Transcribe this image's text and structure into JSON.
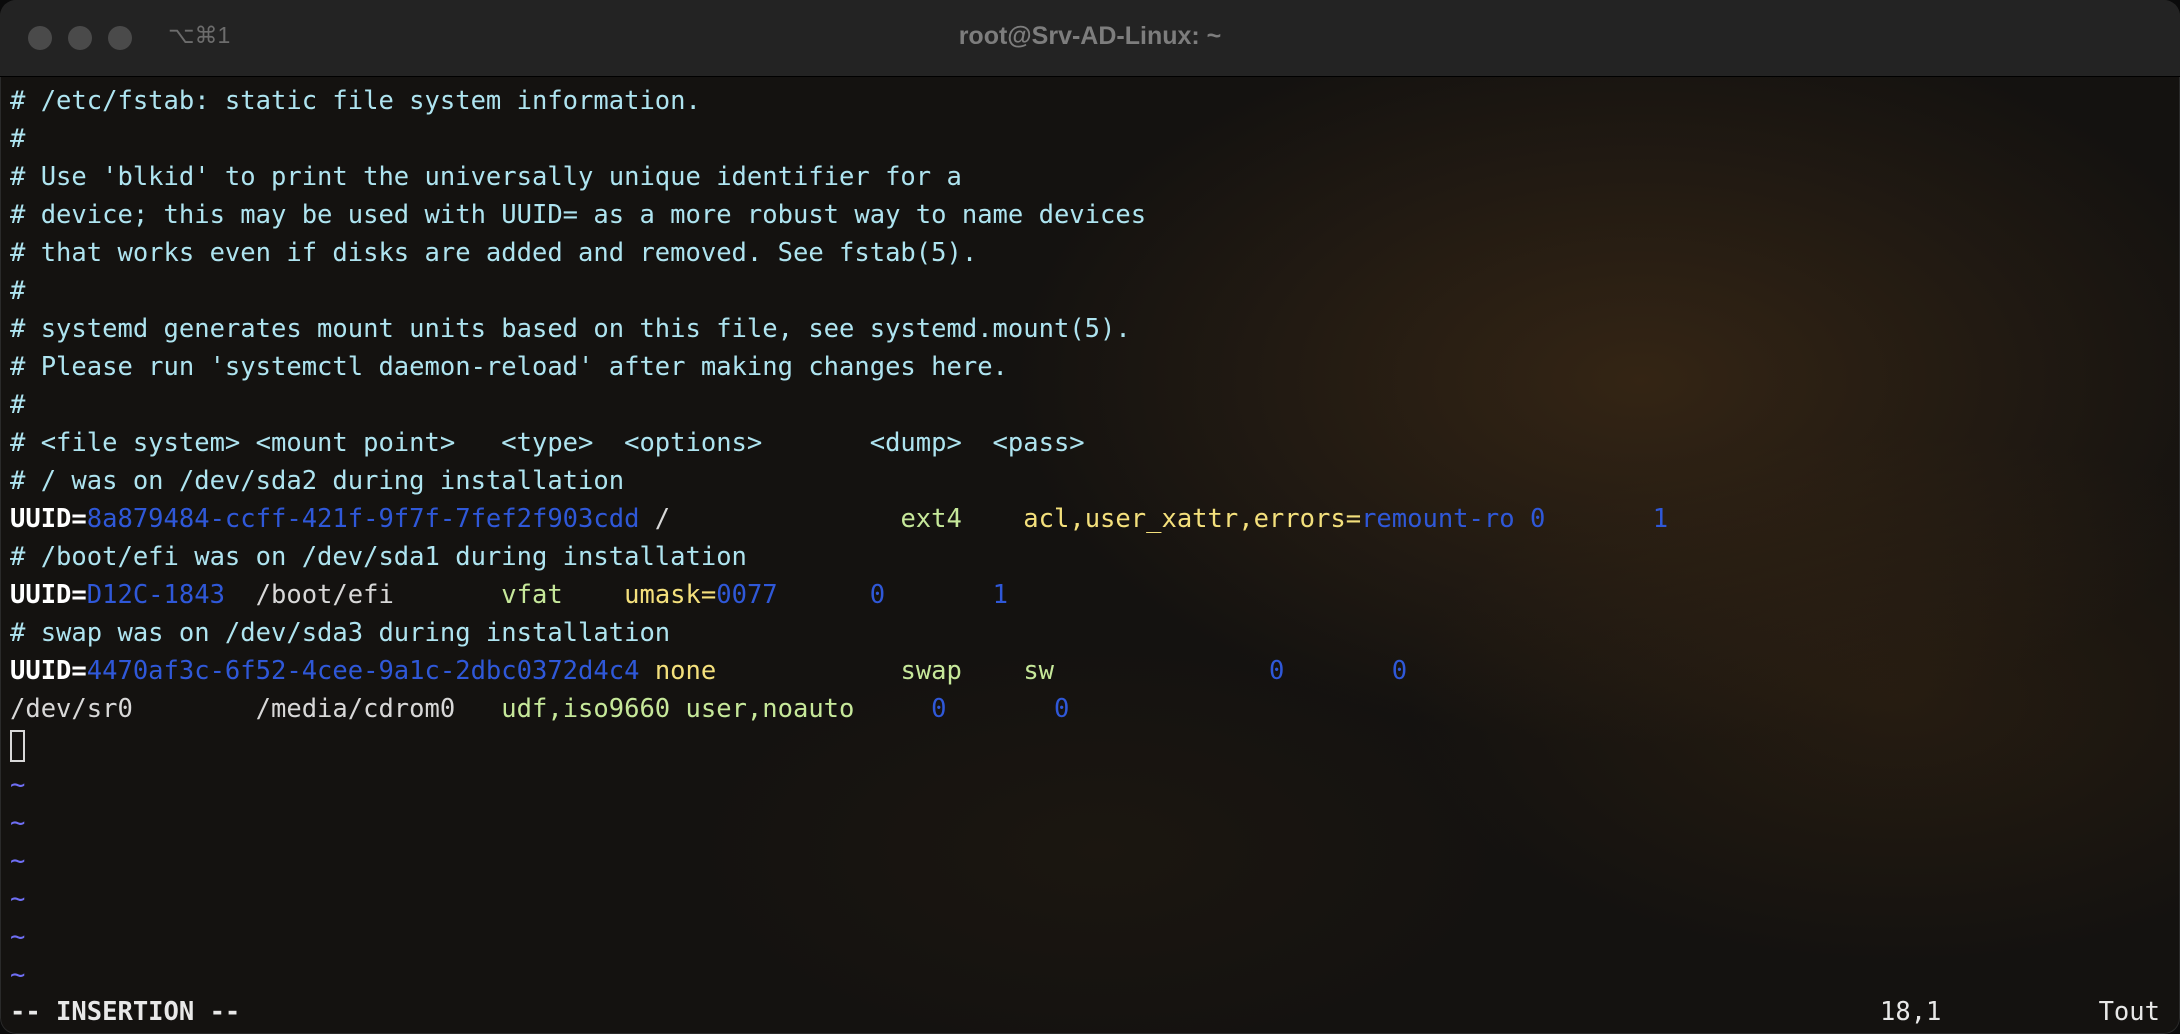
{
  "window": {
    "title": "root@Srv-AD-Linux: ~",
    "shortcut": "⌥⌘1"
  },
  "lines": [
    {
      "cls": "c",
      "text": "# /etc/fstab: static file system information."
    },
    {
      "cls": "c",
      "text": "#"
    },
    {
      "cls": "c",
      "text": "# Use 'blkid' to print the universally unique identifier for a"
    },
    {
      "cls": "c",
      "text": "# device; this may be used with UUID= as a more robust way to name devices"
    },
    {
      "cls": "c",
      "text": "# that works even if disks are added and removed. See fstab(5)."
    },
    {
      "cls": "c",
      "text": "#"
    },
    {
      "cls": "c",
      "text": "# systemd generates mount units based on this file, see systemd.mount(5)."
    },
    {
      "cls": "c",
      "text": "# Please run 'systemctl daemon-reload' after making changes here."
    },
    {
      "cls": "c",
      "text": "#"
    },
    {
      "cls": "c",
      "text": "# <file system> <mount point>   <type>  <options>       <dump>  <pass>"
    },
    {
      "cls": "c",
      "text": "# / was on /dev/sda2 during installation"
    },
    {
      "segments": [
        {
          "cls": "kw",
          "text": "UUID="
        },
        {
          "cls": "b",
          "text": "8a879484-ccff-421f-9f7f-7fef2f903cdd"
        },
        {
          "cls": "w",
          "text": " /               "
        },
        {
          "cls": "g",
          "text": "ext4"
        },
        {
          "cls": "w",
          "text": "    "
        },
        {
          "cls": "y",
          "text": "acl,user_xattr,errors="
        },
        {
          "cls": "b",
          "text": "remount-ro 0       1"
        }
      ]
    },
    {
      "cls": "c",
      "text": "# /boot/efi was on /dev/sda1 during installation"
    },
    {
      "segments": [
        {
          "cls": "kw",
          "text": "UUID="
        },
        {
          "cls": "b",
          "text": "D12C-1843"
        },
        {
          "cls": "w",
          "text": "  /boot/efi       "
        },
        {
          "cls": "g",
          "text": "vfat"
        },
        {
          "cls": "w",
          "text": "    "
        },
        {
          "cls": "y",
          "text": "umask="
        },
        {
          "cls": "b",
          "text": "0077      0       1"
        }
      ]
    },
    {
      "cls": "c",
      "text": "# swap was on /dev/sda3 during installation"
    },
    {
      "segments": [
        {
          "cls": "kw",
          "text": "UUID="
        },
        {
          "cls": "b",
          "text": "4470af3c-6f52-4cee-9a1c-2dbc0372d4c4"
        },
        {
          "cls": "w",
          "text": " "
        },
        {
          "cls": "y",
          "text": "none"
        },
        {
          "cls": "w",
          "text": "            "
        },
        {
          "cls": "g",
          "text": "swap"
        },
        {
          "cls": "w",
          "text": "    "
        },
        {
          "cls": "g",
          "text": "sw"
        },
        {
          "cls": "b",
          "text": "              0       0"
        }
      ]
    },
    {
      "segments": [
        {
          "cls": "w",
          "text": "/dev/sr0        /media/cdrom0   "
        },
        {
          "cls": "g",
          "text": "udf,iso9660 user,noauto"
        },
        {
          "cls": "b",
          "text": "     0       0"
        }
      ]
    },
    {
      "cursor": true
    },
    {
      "cls": "tilde",
      "text": "~"
    },
    {
      "cls": "tilde",
      "text": "~"
    },
    {
      "cls": "tilde",
      "text": "~"
    },
    {
      "cls": "tilde",
      "text": "~"
    },
    {
      "cls": "tilde",
      "text": "~"
    },
    {
      "cls": "tilde",
      "text": "~"
    }
  ],
  "status": {
    "mode": "-- INSERTION --",
    "position": "18,1",
    "scroll": "Tout"
  }
}
